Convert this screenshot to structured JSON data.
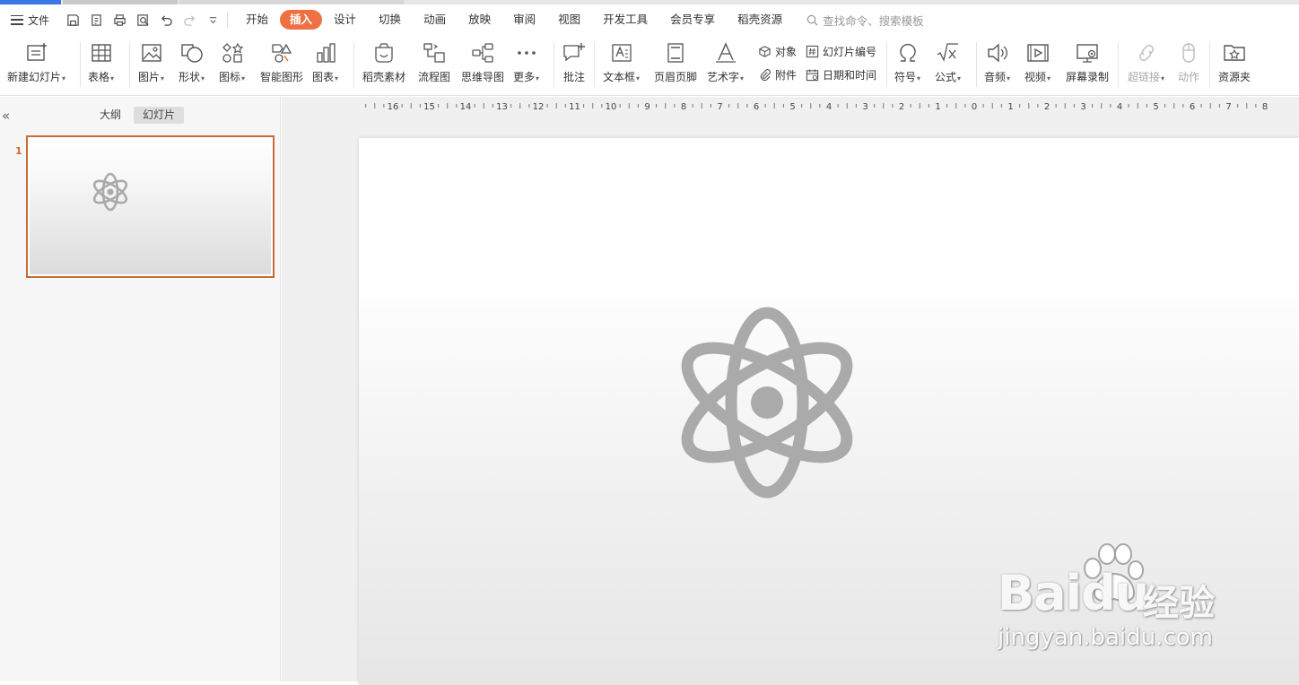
{
  "menu": {
    "file_label": "文件",
    "tabs": [
      "开始",
      "插入",
      "设计",
      "切换",
      "动画",
      "放映",
      "审阅",
      "视图",
      "开发工具",
      "会员专享",
      "稻壳资源"
    ],
    "active_tab": "插入",
    "search_placeholder": "查找命令、搜索模板"
  },
  "ribbon": {
    "new_slide": "新建幻灯片",
    "table": "表格",
    "picture": "图片",
    "shape": "形状",
    "icon": "图标",
    "smartart": "智能图形",
    "chart": "图表",
    "docer": "稻壳素材",
    "flowchart": "流程图",
    "mindmap": "思维导图",
    "more": "更多",
    "comment": "批注",
    "textbox": "文本框",
    "header_footer": "页眉页脚",
    "wordart": "艺术字",
    "object": "对象",
    "attachment": "附件",
    "slide_number": "幻灯片编号",
    "datetime": "日期和时间",
    "symbol": "符号",
    "formula": "公式",
    "audio": "音频",
    "video": "视频",
    "screen_record": "屏幕录制",
    "hyperlink": "超链接",
    "action": "动作",
    "resources": "资源夹"
  },
  "panel": {
    "tab_outline": "大纲",
    "tab_slides": "幻灯片",
    "slide_number": "1",
    "collapse_glyph": "«"
  },
  "ruler": {
    "labels": [
      "16",
      "15",
      "14",
      "13",
      "12",
      "11",
      "10",
      "9",
      "8",
      "7",
      "6",
      "5",
      "4",
      "3",
      "2",
      "1",
      "0",
      "1",
      "2",
      "3",
      "4",
      "5",
      "6",
      "7",
      "8"
    ]
  },
  "watermark": {
    "logo": "Baidu",
    "cn": "经验",
    "url": "jingyan.baidu.com"
  },
  "colors": {
    "accent": "#ef7143",
    "selection": "#c86b35",
    "icon_gray": "#aaaaaa"
  }
}
